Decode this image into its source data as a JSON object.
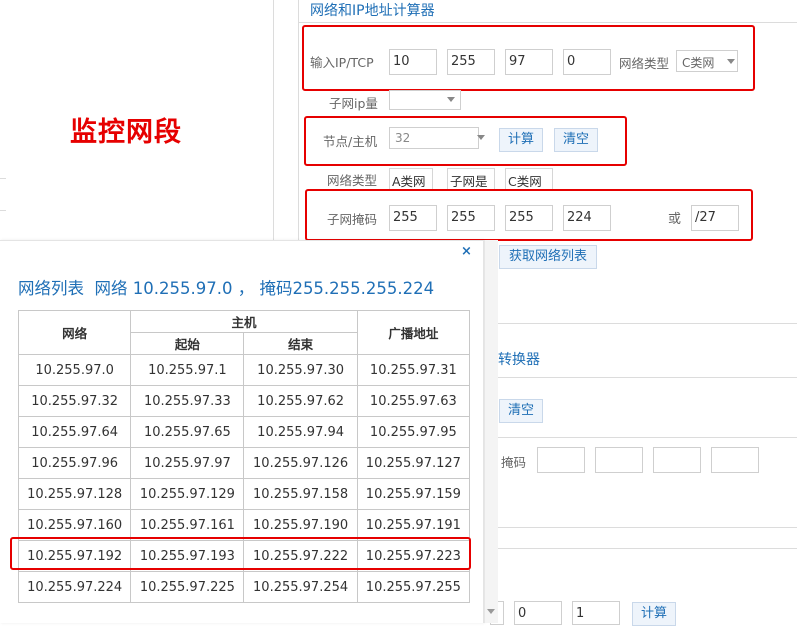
{
  "calc": {
    "title": "网络和IP地址计算器",
    "ip_label": "输入IP/TCP",
    "ip": [
      "10",
      "255",
      "97",
      "0"
    ],
    "net_type_label": "网络类型",
    "net_type_value": "C类网",
    "subnet_count_label": "子网ip量",
    "subnet_count_value": "",
    "node_label": "节点/主机",
    "node_value": "32",
    "calc_button": "计算",
    "clear_button": "清空",
    "result_type_label": "网络类型",
    "result_a": "A类网",
    "result_b": "子网是",
    "result_c": "C类网",
    "mask_label": "子网掩码",
    "mask": [
      "255",
      "255",
      "255",
      "224"
    ],
    "or_label": "或",
    "cidr": "/27",
    "get_list_button": "获取网络列表"
  },
  "annotation": {
    "text": "监控网段",
    "color": "#e60000"
  },
  "converter": {
    "title": "转换器",
    "clear_button": "清空",
    "mask_label": "掩码",
    "mask_values": [
      "",
      "",
      "",
      ""
    ]
  },
  "bottom": {
    "values": [
      "",
      "0",
      "1"
    ],
    "calc_button": "计算"
  },
  "popup": {
    "close": "×",
    "title": "网络列表  网络 10.255.97.0 ， 掩码255.255.255.224",
    "headers": {
      "network": "网络",
      "host": "主机",
      "start": "起始",
      "end": "结束",
      "broadcast": "广播地址"
    },
    "rows": [
      [
        "10.255.97.0",
        "10.255.97.1",
        "10.255.97.30",
        "10.255.97.31"
      ],
      [
        "10.255.97.32",
        "10.255.97.33",
        "10.255.97.62",
        "10.255.97.63"
      ],
      [
        "10.255.97.64",
        "10.255.97.65",
        "10.255.97.94",
        "10.255.97.95"
      ],
      [
        "10.255.97.96",
        "10.255.97.97",
        "10.255.97.126",
        "10.255.97.127"
      ],
      [
        "10.255.97.128",
        "10.255.97.129",
        "10.255.97.158",
        "10.255.97.159"
      ],
      [
        "10.255.97.160",
        "10.255.97.161",
        "10.255.97.190",
        "10.255.97.191"
      ],
      [
        "10.255.97.192",
        "10.255.97.193",
        "10.255.97.222",
        "10.255.97.223"
      ],
      [
        "10.255.97.224",
        "10.255.97.225",
        "10.255.97.254",
        "10.255.97.255"
      ]
    ],
    "highlighted_row": 6
  },
  "colors": {
    "accent": "#1f6fb6",
    "highlight": "#e60000"
  }
}
